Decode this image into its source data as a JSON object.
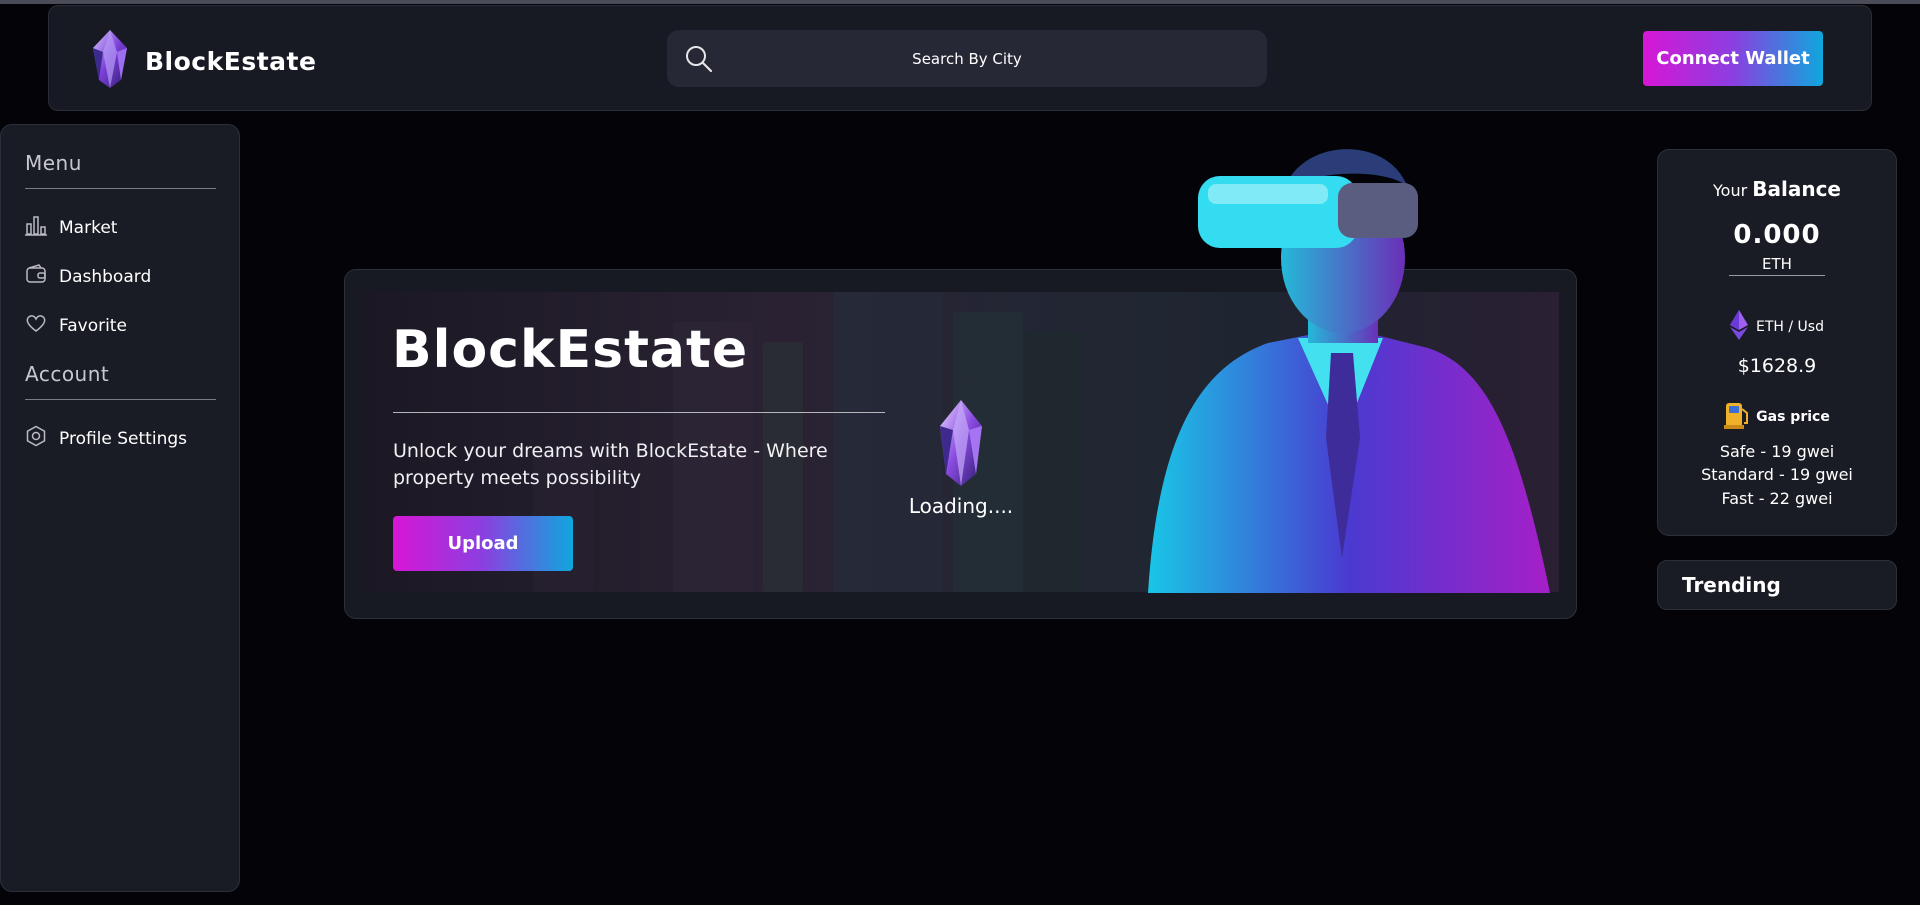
{
  "header": {
    "brand": "BlockEstate",
    "search_placeholder": "Search By City",
    "connect_label": "Connect Wallet"
  },
  "sidebar": {
    "menu_title": "Menu",
    "menu_items": [
      {
        "label": "Market",
        "icon": "bar-chart-icon"
      },
      {
        "label": "Dashboard",
        "icon": "wallet-icon"
      },
      {
        "label": "Favorite",
        "icon": "heart-icon"
      }
    ],
    "account_title": "Account",
    "account_items": [
      {
        "label": "Profile Settings",
        "icon": "settings-hex-icon"
      }
    ]
  },
  "hero": {
    "title": "BlockEstate",
    "subtitle": "Unlock your dreams with BlockEstate - Where property meets possibility",
    "upload_label": "Upload",
    "loading_text": "Loading...."
  },
  "balance": {
    "heading_small": "Your",
    "heading_big": "Balance",
    "value": "0.000",
    "unit": "ETH",
    "pair_label": "ETH / Usd",
    "eth_price": "$1628.9",
    "gas_label": "Gas price",
    "gas_safe": "Safe - 19 gwei",
    "gas_standard": "Standard - 19 gwei",
    "gas_fast": "Fast - 22 gwei"
  },
  "trending": {
    "title": "Trending"
  },
  "colors": {
    "gradient_start": "#d716d6",
    "gradient_end": "#0fa7dd",
    "panel": "#1a1c25",
    "background": "#030308"
  }
}
